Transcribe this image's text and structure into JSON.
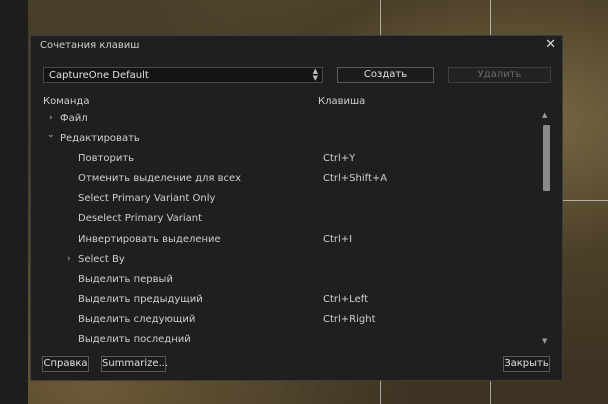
{
  "dialog": {
    "title": "Сочетания клавиш",
    "preset_value": "CaptureOne Default",
    "create_label": "Создать",
    "delete_label": "Удалить",
    "col_command": "Команда",
    "col_key": "Клавиша",
    "rows": [
      {
        "cmd": "Файл",
        "key": "",
        "expander": "›"
      },
      {
        "cmd": "Редактировать",
        "key": "",
        "expander": "⌄"
      },
      {
        "cmd": "Повторить",
        "key": "Ctrl+Y"
      },
      {
        "cmd": "Отменить выделение для всех",
        "key": "Ctrl+Shift+A"
      },
      {
        "cmd": "Select Primary Variant Only",
        "key": ""
      },
      {
        "cmd": "Deselect Primary Variant",
        "key": ""
      },
      {
        "cmd": "Инвертировать выделение",
        "key": "Ctrl+I"
      },
      {
        "cmd": "Select By",
        "key": "",
        "expander": "›"
      },
      {
        "cmd": "Выделить первый",
        "key": ""
      },
      {
        "cmd": "Выделить предыдущий",
        "key": "Ctrl+Left"
      },
      {
        "cmd": "Выделить следующий",
        "key": "Ctrl+Right"
      },
      {
        "cmd": "Выделить последний",
        "key": ""
      }
    ],
    "help_label": "Справка",
    "summarize_label": "Summarize...",
    "close_label": "Закрыть"
  }
}
